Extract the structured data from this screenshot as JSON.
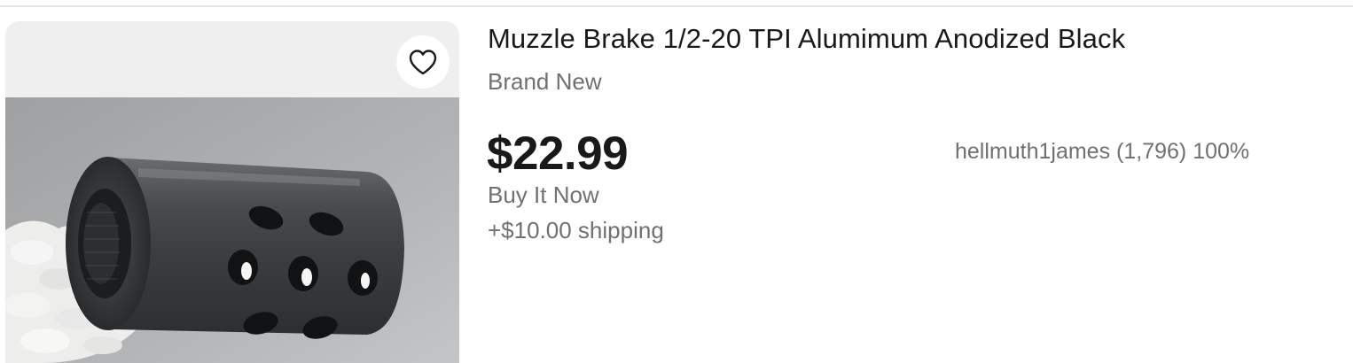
{
  "listing": {
    "title": "Muzzle Brake 1/2-20 TPI Alumimum Anodized Black",
    "condition": "Brand New",
    "price": "$22.99",
    "format": "Buy It Now",
    "shipping": "+$10.00 shipping",
    "seller": "hellmuth1james (1,796) 100%",
    "image_alt": "Muzzle brake product photo"
  },
  "watch_button": {
    "icon": "heart-outline-icon",
    "label": "Add to watchlist"
  },
  "colors": {
    "text_primary": "#191919",
    "text_secondary": "#707070",
    "image_background": "#efefef",
    "divider": "#e5e5e5"
  }
}
